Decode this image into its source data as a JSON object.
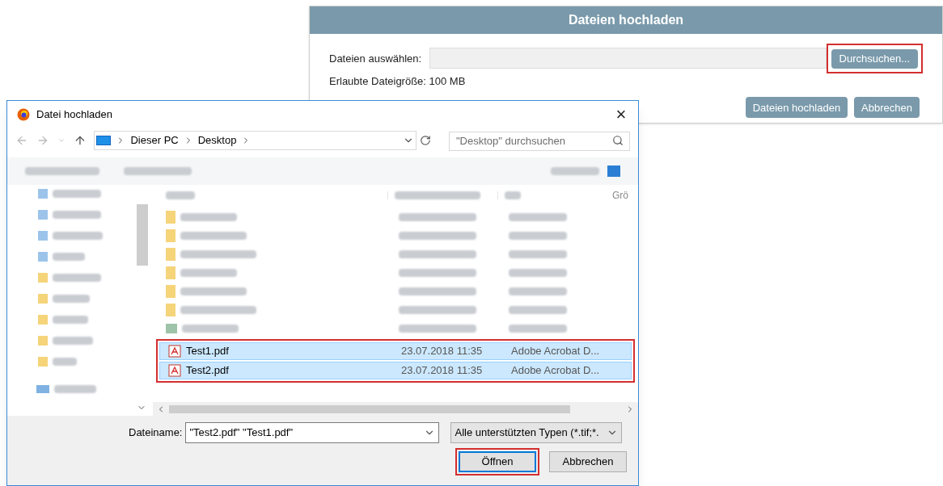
{
  "web_dialog": {
    "title": "Dateien hochladen",
    "select_label": "Dateien auswählen:",
    "browse_button": {
      "label": "Durchsuchen...",
      "highlighted": true
    },
    "size_note": "Erlaubte Dateigröße: 100 MB",
    "buttons": [
      {
        "label": "Dateien hochladen"
      },
      {
        "label": "Abbrechen"
      }
    ]
  },
  "file_dialog": {
    "title": "Datei hochladen",
    "close": "×",
    "breadcrumb": [
      "Dieser PC",
      "Desktop"
    ],
    "search": {
      "placeholder": "\"Desktop\" durchsuchen"
    },
    "column_4_partial": "Grö",
    "selection_highlighted": true,
    "files": [
      {
        "kind": "folder"
      },
      {
        "kind": "folder"
      },
      {
        "kind": "folder"
      },
      {
        "kind": "folder"
      },
      {
        "kind": "folder"
      },
      {
        "kind": "folder"
      },
      {
        "kind": "image"
      },
      {
        "kind": "pdf",
        "name": "Test1.pdf",
        "modified": "23.07.2018 11:35",
        "type": "Adobe Acrobat D...",
        "selected": true
      },
      {
        "kind": "pdf",
        "name": "Test2.pdf",
        "modified": "23.07.2018 11:35",
        "type": "Adobe Acrobat D...",
        "selected": true
      }
    ],
    "filename_label": "Dateiname:",
    "filename_value": "\"Test2.pdf\" \"Test1.pdf\"",
    "filter": "Alle unterstützten Typen (*.tif;*.",
    "open_button": {
      "label": "Öffnen",
      "highlighted": true
    },
    "cancel_button": {
      "label": "Abbrechen"
    }
  }
}
